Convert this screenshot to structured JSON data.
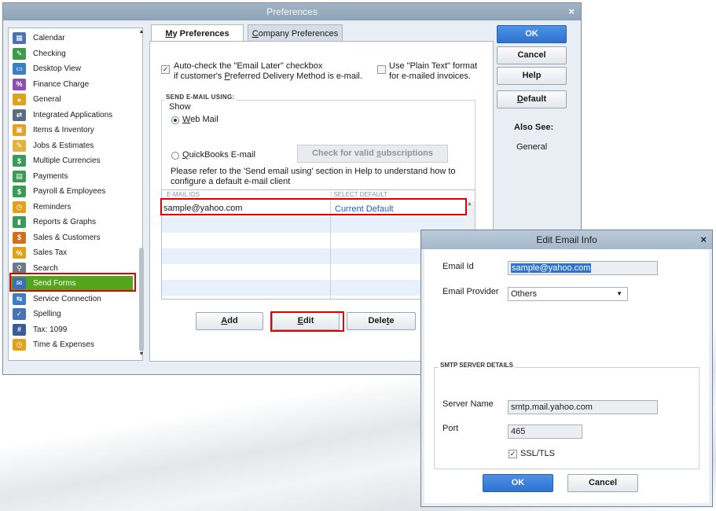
{
  "preferences": {
    "title": "Preferences",
    "close": "×",
    "sidebar": {
      "items": [
        {
          "label": "Calendar",
          "icon": "calendar-icon",
          "color": "#4a72b8",
          "glyph": "▦"
        },
        {
          "label": "Checking",
          "icon": "checking-icon",
          "color": "#3b9a4b",
          "glyph": "✎"
        },
        {
          "label": "Desktop View",
          "icon": "desktop-view-icon",
          "color": "#3a7fc4",
          "glyph": "▭"
        },
        {
          "label": "Finance Charge",
          "icon": "finance-charge-icon",
          "color": "#8e4fb0",
          "glyph": "%"
        },
        {
          "label": "General",
          "icon": "general-icon",
          "color": "#e0a21a",
          "glyph": "●"
        },
        {
          "label": "Integrated Applications",
          "icon": "integrated-applications-icon",
          "color": "#5a6d80",
          "glyph": "⇄"
        },
        {
          "label": "Items & Inventory",
          "icon": "items-inventory-icon",
          "color": "#e3a220",
          "glyph": "▣"
        },
        {
          "label": "Jobs & Estimates",
          "icon": "jobs-estimates-icon",
          "color": "#e2b33a",
          "glyph": "✎"
        },
        {
          "label": "Multiple Currencies",
          "icon": "multiple-currencies-icon",
          "color": "#3a9a57",
          "glyph": "$"
        },
        {
          "label": "Payments",
          "icon": "payments-icon",
          "color": "#3a9a57",
          "glyph": "▤"
        },
        {
          "label": "Payroll & Employees",
          "icon": "payroll-employees-icon",
          "color": "#3a9a57",
          "glyph": "$"
        },
        {
          "label": "Reminders",
          "icon": "reminders-icon",
          "color": "#e0a21a",
          "glyph": "◷"
        },
        {
          "label": "Reports & Graphs",
          "icon": "reports-graphs-icon",
          "color": "#3a9a57",
          "glyph": "▮"
        },
        {
          "label": "Sales & Customers",
          "icon": "sales-customers-icon",
          "color": "#d0701a",
          "glyph": "$"
        },
        {
          "label": "Sales Tax",
          "icon": "sales-tax-icon",
          "color": "#e0a21a",
          "glyph": "%"
        },
        {
          "label": "Search",
          "icon": "search-icon",
          "color": "#6d7a86",
          "glyph": "⚲"
        },
        {
          "label": "Send Forms",
          "icon": "send-forms-icon",
          "color": "#3d6fb8",
          "glyph": "✉"
        },
        {
          "label": "Service Connection",
          "icon": "service-connection-icon",
          "color": "#3a7fc4",
          "glyph": "⇆"
        },
        {
          "label": "Spelling",
          "icon": "spelling-icon",
          "color": "#4a72b8",
          "glyph": "✓"
        },
        {
          "label": "Tax: 1099",
          "icon": "tax-1099-icon",
          "color": "#3a5a9a",
          "glyph": "#"
        },
        {
          "label": "Time & Expenses",
          "icon": "time-expenses-icon",
          "color": "#e0a21a",
          "glyph": "◷"
        }
      ],
      "selected": "Send Forms"
    },
    "tabs": {
      "my_prefix": "",
      "my_ul": "M",
      "my_rest": "y Preferences",
      "company_ul": "C",
      "company_rest": "ompany Preferences"
    },
    "auto_check": {
      "line1": "Auto-check the \"Email Later\" checkbox",
      "line2a": "if customer's ",
      "line2_ul": "P",
      "line2b": "referred Delivery Method is e-mail.",
      "checked": true
    },
    "plain_text": {
      "line1": "Use \"Plain Text\" format",
      "line2": "for e-mailed invoices.",
      "checked": false
    },
    "send_email_using": {
      "group_title": "SEND E-MAIL USING:",
      "show_label": "Show",
      "web_mail_ul": "W",
      "web_mail_rest": "eb Mail",
      "web_mail_selected": true,
      "qb_ul": "Q",
      "qb_rest": "uickBooks E-mail",
      "check_subs_a": "Check for valid ",
      "check_subs_ul": "s",
      "check_subs_b": "ubscriptions",
      "help_line1": "Please refer to the 'Send email using' section in Help to understand how to",
      "help_line2": "configure a default e-mail client"
    },
    "grid": {
      "col1": "E-MAIL IDS",
      "col2": "SELECT DEFAULT",
      "rows": [
        {
          "email": "sample@yahoo.com",
          "default": "Current Default"
        }
      ]
    },
    "buttons": {
      "add_ul": "A",
      "add_rest": "dd",
      "edit_ul": "E",
      "edit_rest": "dit",
      "delete_a": "Dele",
      "delete_ul": "t",
      "delete_b": "e"
    },
    "right": {
      "ok": "OK",
      "cancel": "Cancel",
      "help": "Help",
      "default_ul": "D",
      "default_rest": "efault",
      "also_see": "Also See:",
      "also_see_link": "General"
    }
  },
  "edit_dialog": {
    "title": "Edit Email Info",
    "close": "×",
    "email_id_label": "Email Id",
    "email_id_value": "sample@yahoo.com",
    "provider_label": "Email Provider",
    "provider_value": "Others",
    "smtp_title": "SMTP SERVER DETAILS",
    "server_name_label": "Server Name",
    "server_name_value": "smtp.mail.yahoo.com",
    "port_label": "Port",
    "port_value": "465",
    "ssl_label": "SSL/TLS",
    "ssl_checked": true,
    "ok": "OK",
    "cancel": "Cancel"
  },
  "colors": {
    "selected_green": "#55a51c",
    "highlight_red": "#e00000",
    "primary_blue": "#2f72d0",
    "link_blue": "#1f5fbf"
  }
}
